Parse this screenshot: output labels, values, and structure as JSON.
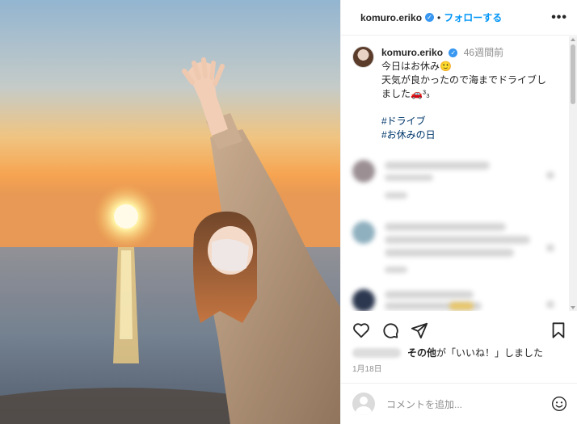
{
  "post": {
    "username": "komuro.eriko",
    "verified_mark": "✓",
    "separator": "•",
    "follow_label": "フォローする",
    "more_label": "•••"
  },
  "caption": {
    "username": "komuro.eriko",
    "time": "46週間前",
    "line1": "今日はお休み🙂",
    "line2": "天気が良かったので海までドライブし",
    "line3": "ました🚗³₃",
    "hashtag1": "#ドライブ",
    "hashtag2": "#お休みの日"
  },
  "likes": {
    "text_bold": "その他",
    "text_rest": "が「いいね！」しました"
  },
  "date": "1月18日",
  "comment_input": {
    "placeholder": "コメントを追加..."
  },
  "icons": {
    "like": "heart-icon",
    "comment": "comment-icon",
    "share": "share-icon",
    "save": "bookmark-icon",
    "emoji": "emoji-icon"
  },
  "colors": {
    "accent": "#0095f6",
    "verified": "#3897f0",
    "hashtag": "#00376b",
    "muted": "#8e8e8e"
  }
}
